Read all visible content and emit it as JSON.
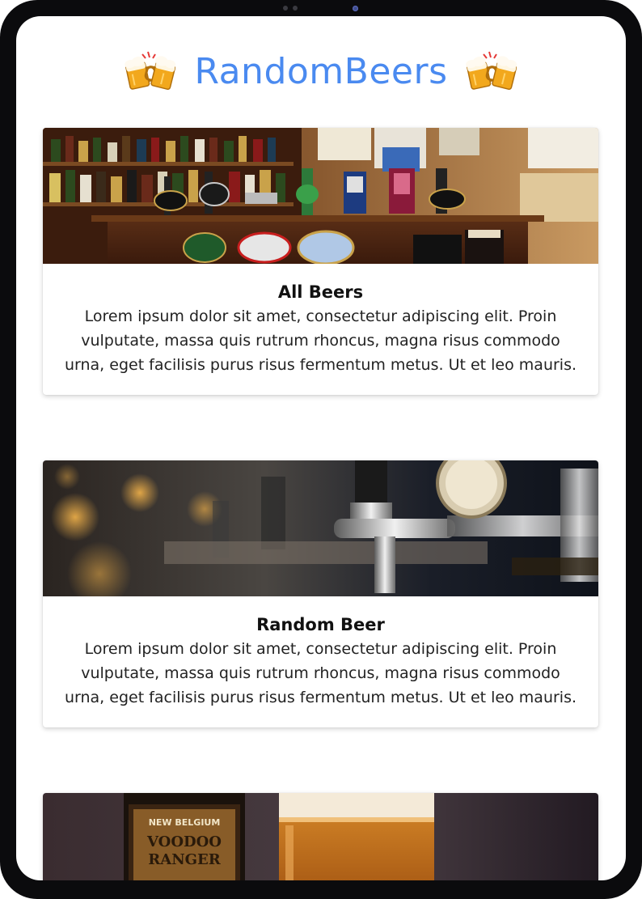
{
  "app": {
    "title": "RandomBeers"
  },
  "header": {
    "title": "RandomBeers",
    "left_icon": "beer-cheers-icon",
    "right_icon": "beer-cheers-icon",
    "title_color": "#4a8af0"
  },
  "cards": [
    {
      "title": "All Beers",
      "text": "Lorem ipsum dolor sit amet, consectetur adipiscing elit. Proin vulputate, massa quis rutrum rhoncus, magna risus commodo urna, eget facilisis purus risus fermentum metus. Ut et leo mauris.",
      "image": "bar-taps-photo"
    },
    {
      "title": "Random Beer",
      "text": "Lorem ipsum dolor sit amet, consectetur adipiscing elit. Proin vulputate, massa quis rutrum rhoncus, magna risus commodo urna, eget facilisis purus risus fermentum metus. Ut et leo mauris.",
      "image": "beer-tap-closeup-photo"
    },
    {
      "title": "",
      "text": "",
      "image": "beer-bottle-and-glass-photo",
      "image_labels": [
        "NEW BELGIUM",
        "VOODOO",
        "RANGER"
      ]
    }
  ]
}
